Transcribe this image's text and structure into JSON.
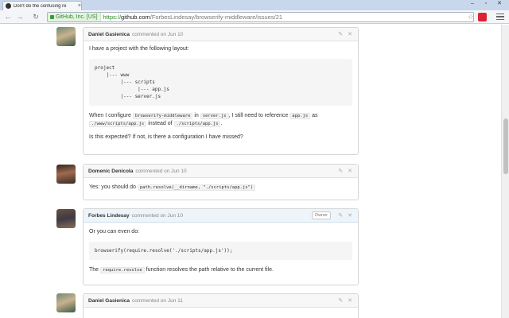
{
  "browser": {
    "tab_title": "Don't do the confusing re",
    "tab_close": "×",
    "ev_label": "GitHub, Inc. [US]",
    "url_scheme": "https://",
    "url_host": "github.com",
    "url_path": "/ForbesLindesay/browserify-middleware/issues/21",
    "back": "←",
    "forward": "→",
    "reload": "↻",
    "star": "☆",
    "minimize": "–",
    "restore": "▫",
    "close": "✕"
  },
  "comments": [
    {
      "author": "Daniel Gasienica",
      "meta": "commented on Jun 10",
      "p1": "I have a project with the following layout:",
      "code_block": "project\n    |--- www\n         |--- scripts\n               |--- app.js\n         |--- server.js",
      "p2_a": "When I configure",
      "p2_code1": "browserify-middleware",
      "p2_b": "in",
      "p2_code2": "server.js",
      "p2_c": ", I still need to reference",
      "p2_code3": "app.js",
      "p2_d": "as",
      "p2_code4": "./www/scripts/app.js",
      "p2_e": "instead of",
      "p2_code5": "./scripts/app.js",
      "p2_f": ".",
      "p3": "Is this expected? If not, is there a configuration I have missed?"
    },
    {
      "author": "Domenic Denicola",
      "meta": "commented on Jun 10",
      "p1_a": "Yes: you should do",
      "p1_code": "path.resolve(__dirname, \"./scripts/app.js\")"
    },
    {
      "author": "Forbes Lindesay",
      "meta": "commented on Jun 10",
      "badge": "Owner",
      "p1": "Or you can even do:",
      "code_block": "browserify(require.resolve('./scripts/app.js'));",
      "p2_a": "The",
      "p2_code": "require.resolve",
      "p2_b": "function resolves the path relative to the current file."
    },
    {
      "author": "Daniel Gasienica",
      "meta": "commented on Jun 11"
    }
  ],
  "icons": {
    "edit": "✎",
    "delete": "✕"
  }
}
